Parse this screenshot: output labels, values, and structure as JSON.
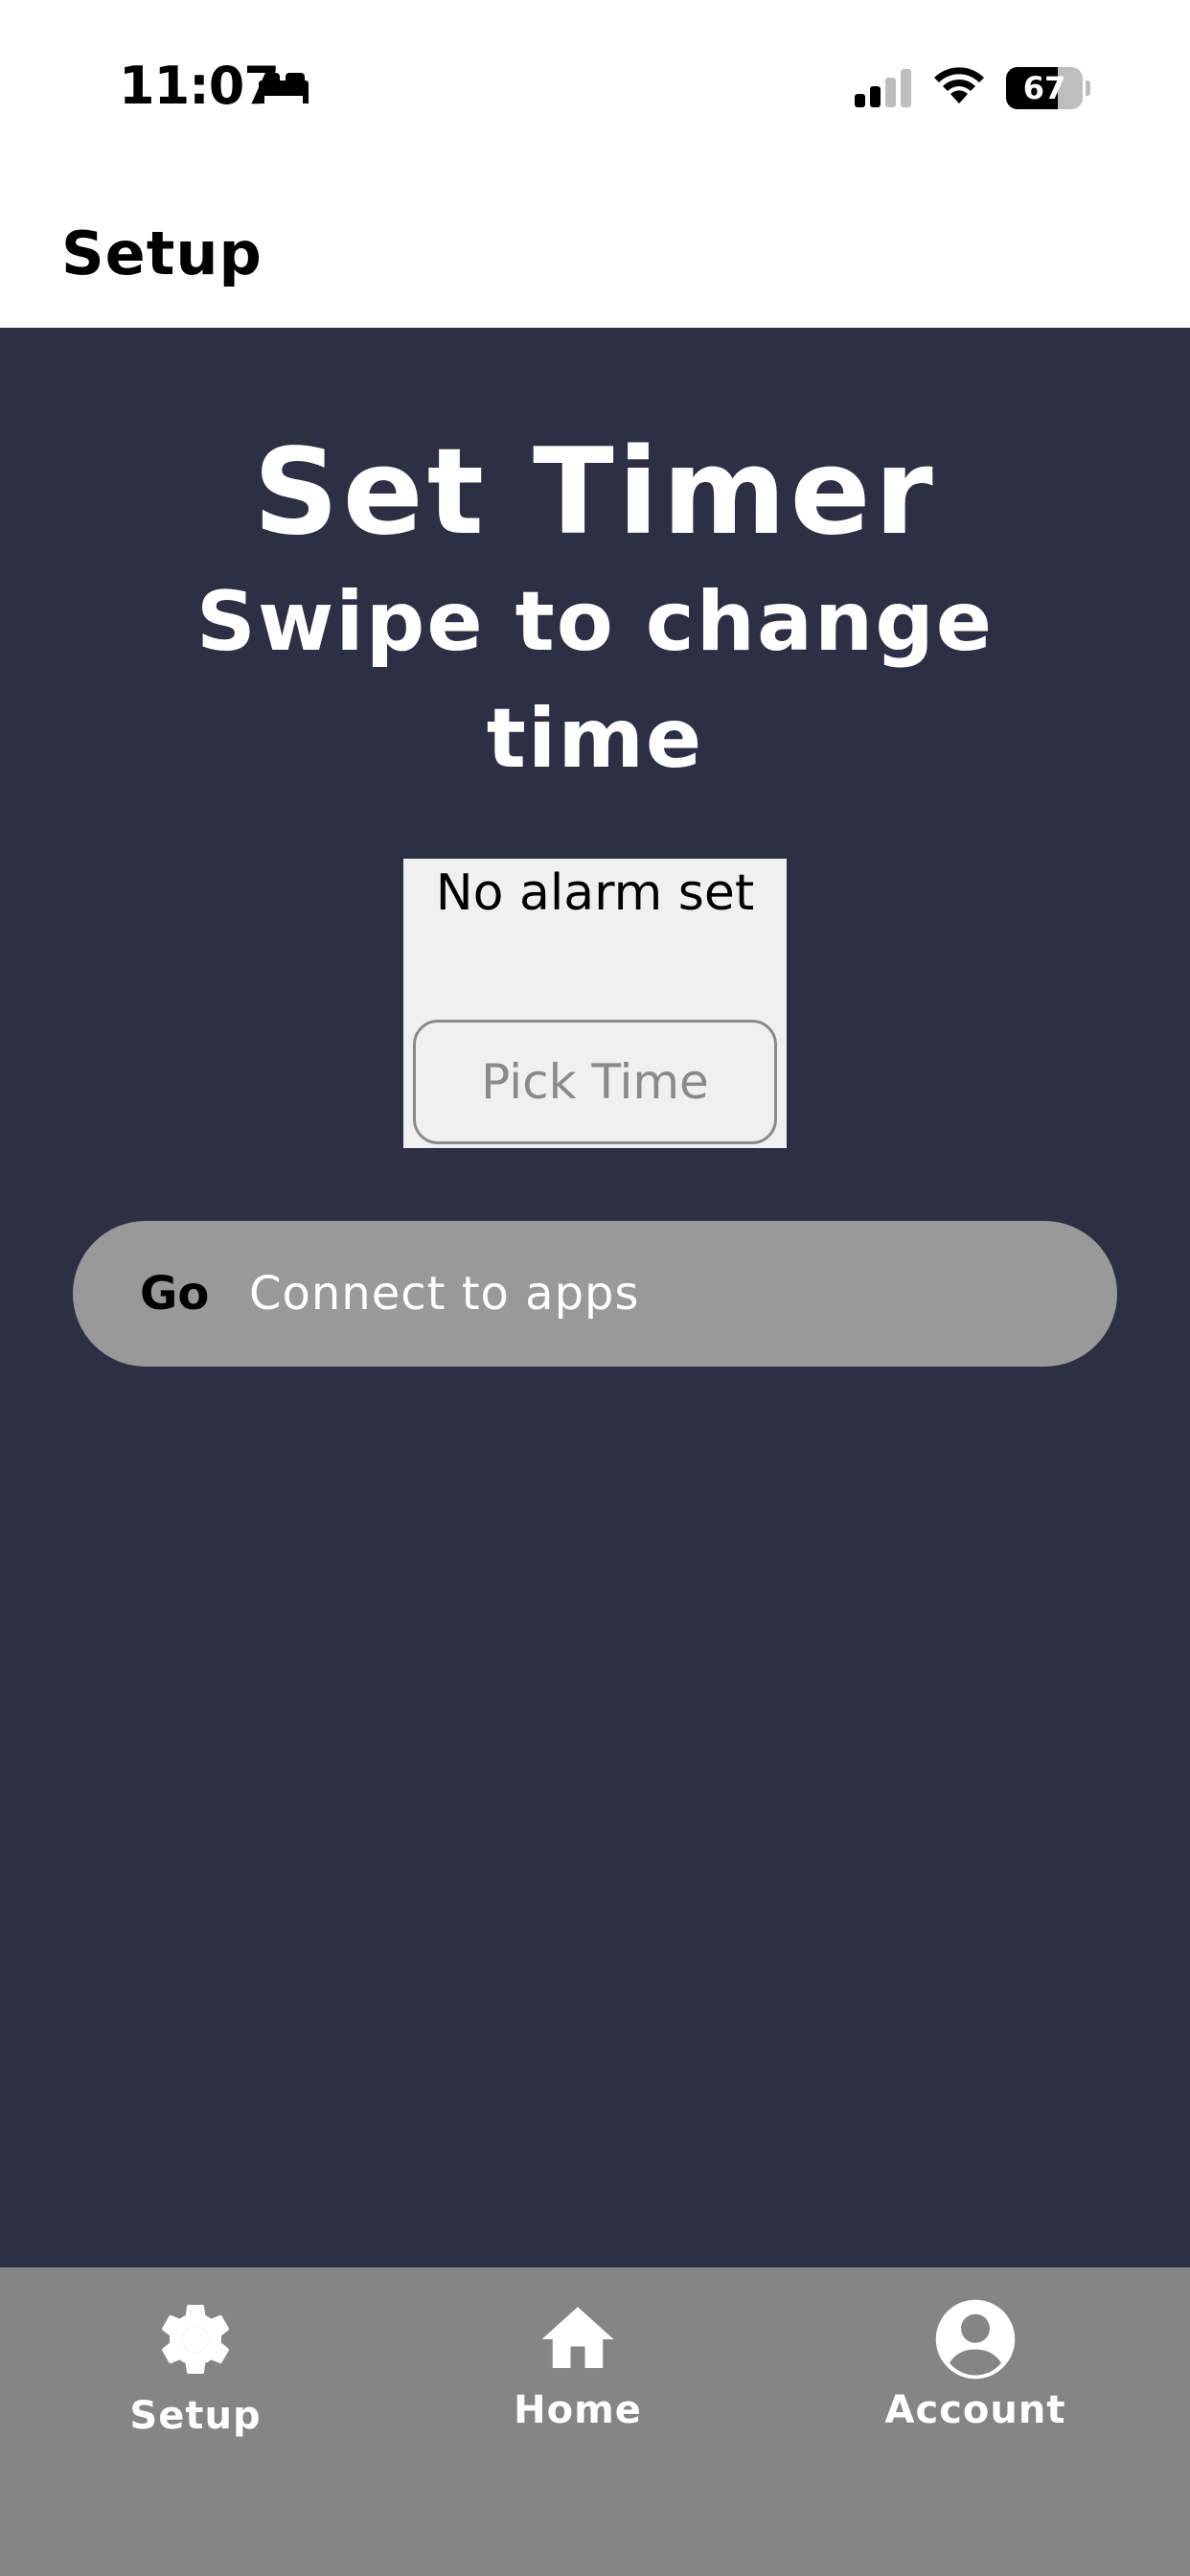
{
  "status_bar": {
    "time": "11:07",
    "battery": "67",
    "icons": [
      "bed-icon",
      "signal-icon",
      "wifi-icon",
      "battery-icon"
    ]
  },
  "header": {
    "title": "Setup"
  },
  "main": {
    "title": "Set Timer",
    "subtitle": "Swipe to change time",
    "alarm_status": "No alarm set",
    "pick_time_label": "Pick Time",
    "connect": {
      "go_label": "Go",
      "label": "Connect to apps"
    }
  },
  "bottom_nav": {
    "items": [
      {
        "label": "Setup",
        "icon": "gear-icon"
      },
      {
        "label": "Home",
        "icon": "home-icon"
      },
      {
        "label": "Account",
        "icon": "account-icon"
      }
    ]
  },
  "colors": {
    "background": "#2d3045",
    "header": "#ffffff",
    "button_gray": "#999999",
    "nav_gray": "#858585",
    "alarm_box": "#f0f0f0"
  }
}
